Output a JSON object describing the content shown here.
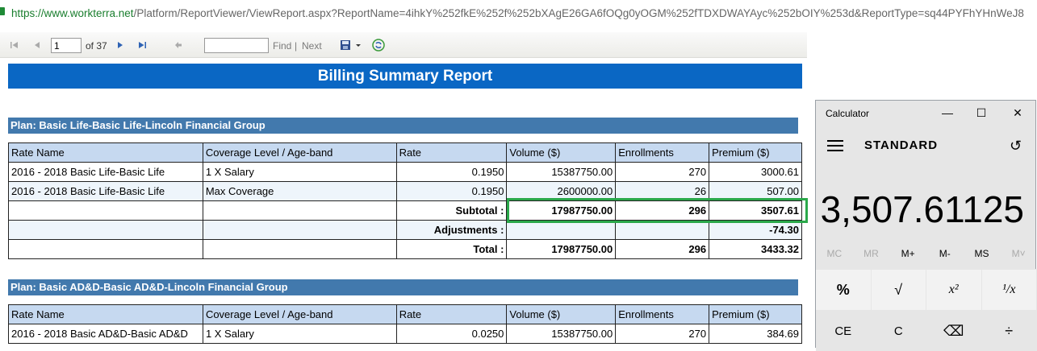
{
  "browser": {
    "url_host": "https://www.workterra.net",
    "url_path": "/Platform/ReportViewer/ViewReport.aspx?ReportName=4ihkY%252fkE%252f%252bXAgE26GA6fOQg0yOGM%252fTDXDWAYAyc%252bOIY%253d&ReportType=sq44PYFhYHnWeJ8"
  },
  "toolbar": {
    "page_value": "1",
    "of_label": "of 37",
    "find_label": "Find",
    "separator": "|",
    "next_label": "Next",
    "icons": [
      "first-page-icon",
      "prev-page-icon",
      "next-page-icon",
      "last-page-icon",
      "back-icon",
      "export-icon",
      "refresh-icon"
    ]
  },
  "report": {
    "title": "Billing Summary Report",
    "columns": [
      "Rate Name",
      "Coverage Level / Age-band",
      "Rate",
      "Volume ($)",
      "Enrollments",
      "Premium ($)"
    ],
    "plans": [
      {
        "header": "Plan: Basic Life-Basic Life-Lincoln Financial Group",
        "rows": [
          [
            "2016 - 2018 Basic Life-Basic Life",
            "1 X Salary",
            "0.1950",
            "15387750.00",
            "270",
            "3000.61"
          ],
          [
            "2016 - 2018 Basic Life-Basic Life",
            "Max Coverage",
            "0.1950",
            "2600000.00",
            "26",
            "507.00"
          ]
        ],
        "subtotal": {
          "label": "Subtotal :",
          "volume": "17987750.00",
          "enrollments": "296",
          "premium": "3507.61"
        },
        "adjustments": {
          "label": "Adjustments :",
          "premium": "-74.30"
        },
        "total": {
          "label": "Total :",
          "volume": "17987750.00",
          "enrollments": "296",
          "premium": "3433.32"
        }
      },
      {
        "header": "Plan: Basic AD&D-Basic AD&D-Lincoln Financial Group",
        "rows": [
          [
            "2016 - 2018 Basic AD&D-Basic AD&D",
            "1 X Salary",
            "0.0250",
            "15387750.00",
            "270",
            "384.69"
          ]
        ]
      }
    ]
  },
  "calculator": {
    "window_title": "Calculator",
    "mode": "STANDARD",
    "display": "3,507.61125",
    "memory": [
      "MC",
      "MR",
      "M+",
      "M-",
      "MS",
      "M˅"
    ],
    "row1": [
      "%",
      "√",
      "x²",
      "¹/x"
    ],
    "row2": [
      "CE",
      "C",
      "⌫",
      "÷"
    ]
  }
}
